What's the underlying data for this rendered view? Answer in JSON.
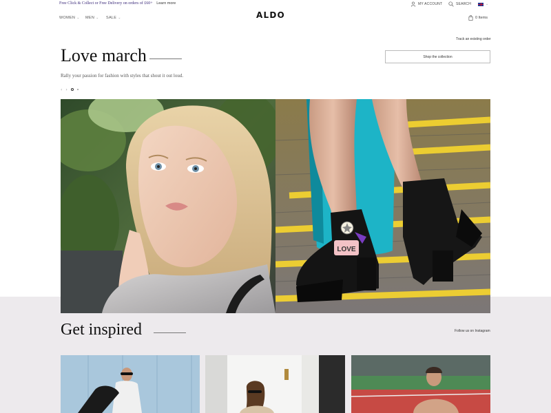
{
  "topbar": {
    "promo": "Free Click & Collect or Free Delivery on orders of £60+",
    "learn_more": "Learn more",
    "my_account": "MY ACCOUNT",
    "search": "SEARCH"
  },
  "nav": {
    "items": [
      {
        "label": "WOMEN"
      },
      {
        "label": "MEN"
      },
      {
        "label": "SALE"
      }
    ],
    "chevron": "⌄"
  },
  "brand": {
    "logo": "ALDO"
  },
  "cart": {
    "label": "0 Items"
  },
  "hero": {
    "track_order": "Track an existing order",
    "title": "Love march",
    "subtitle": "Rally your passion for fashion with styles that shout it out loud.",
    "shop_button": "Shop the collection",
    "prev": "‹",
    "next": "›",
    "slide_count": 2,
    "active_slide": 1,
    "patch_text": "LOVE"
  },
  "inspired": {
    "title": "Get inspired",
    "instagram_link": "Follow us on Instagram"
  },
  "colors": {
    "promo_text": "#3b2a7a",
    "band_bg": "#edeaed",
    "flag_blue": "#1f3a93",
    "flag_red": "#c8102e"
  },
  "icons": {
    "account": "user-icon",
    "search": "search-icon",
    "flag": "uk-flag-icon",
    "cart": "shopping-bag-icon",
    "prev": "chevron-left-icon",
    "next": "chevron-right-icon"
  }
}
